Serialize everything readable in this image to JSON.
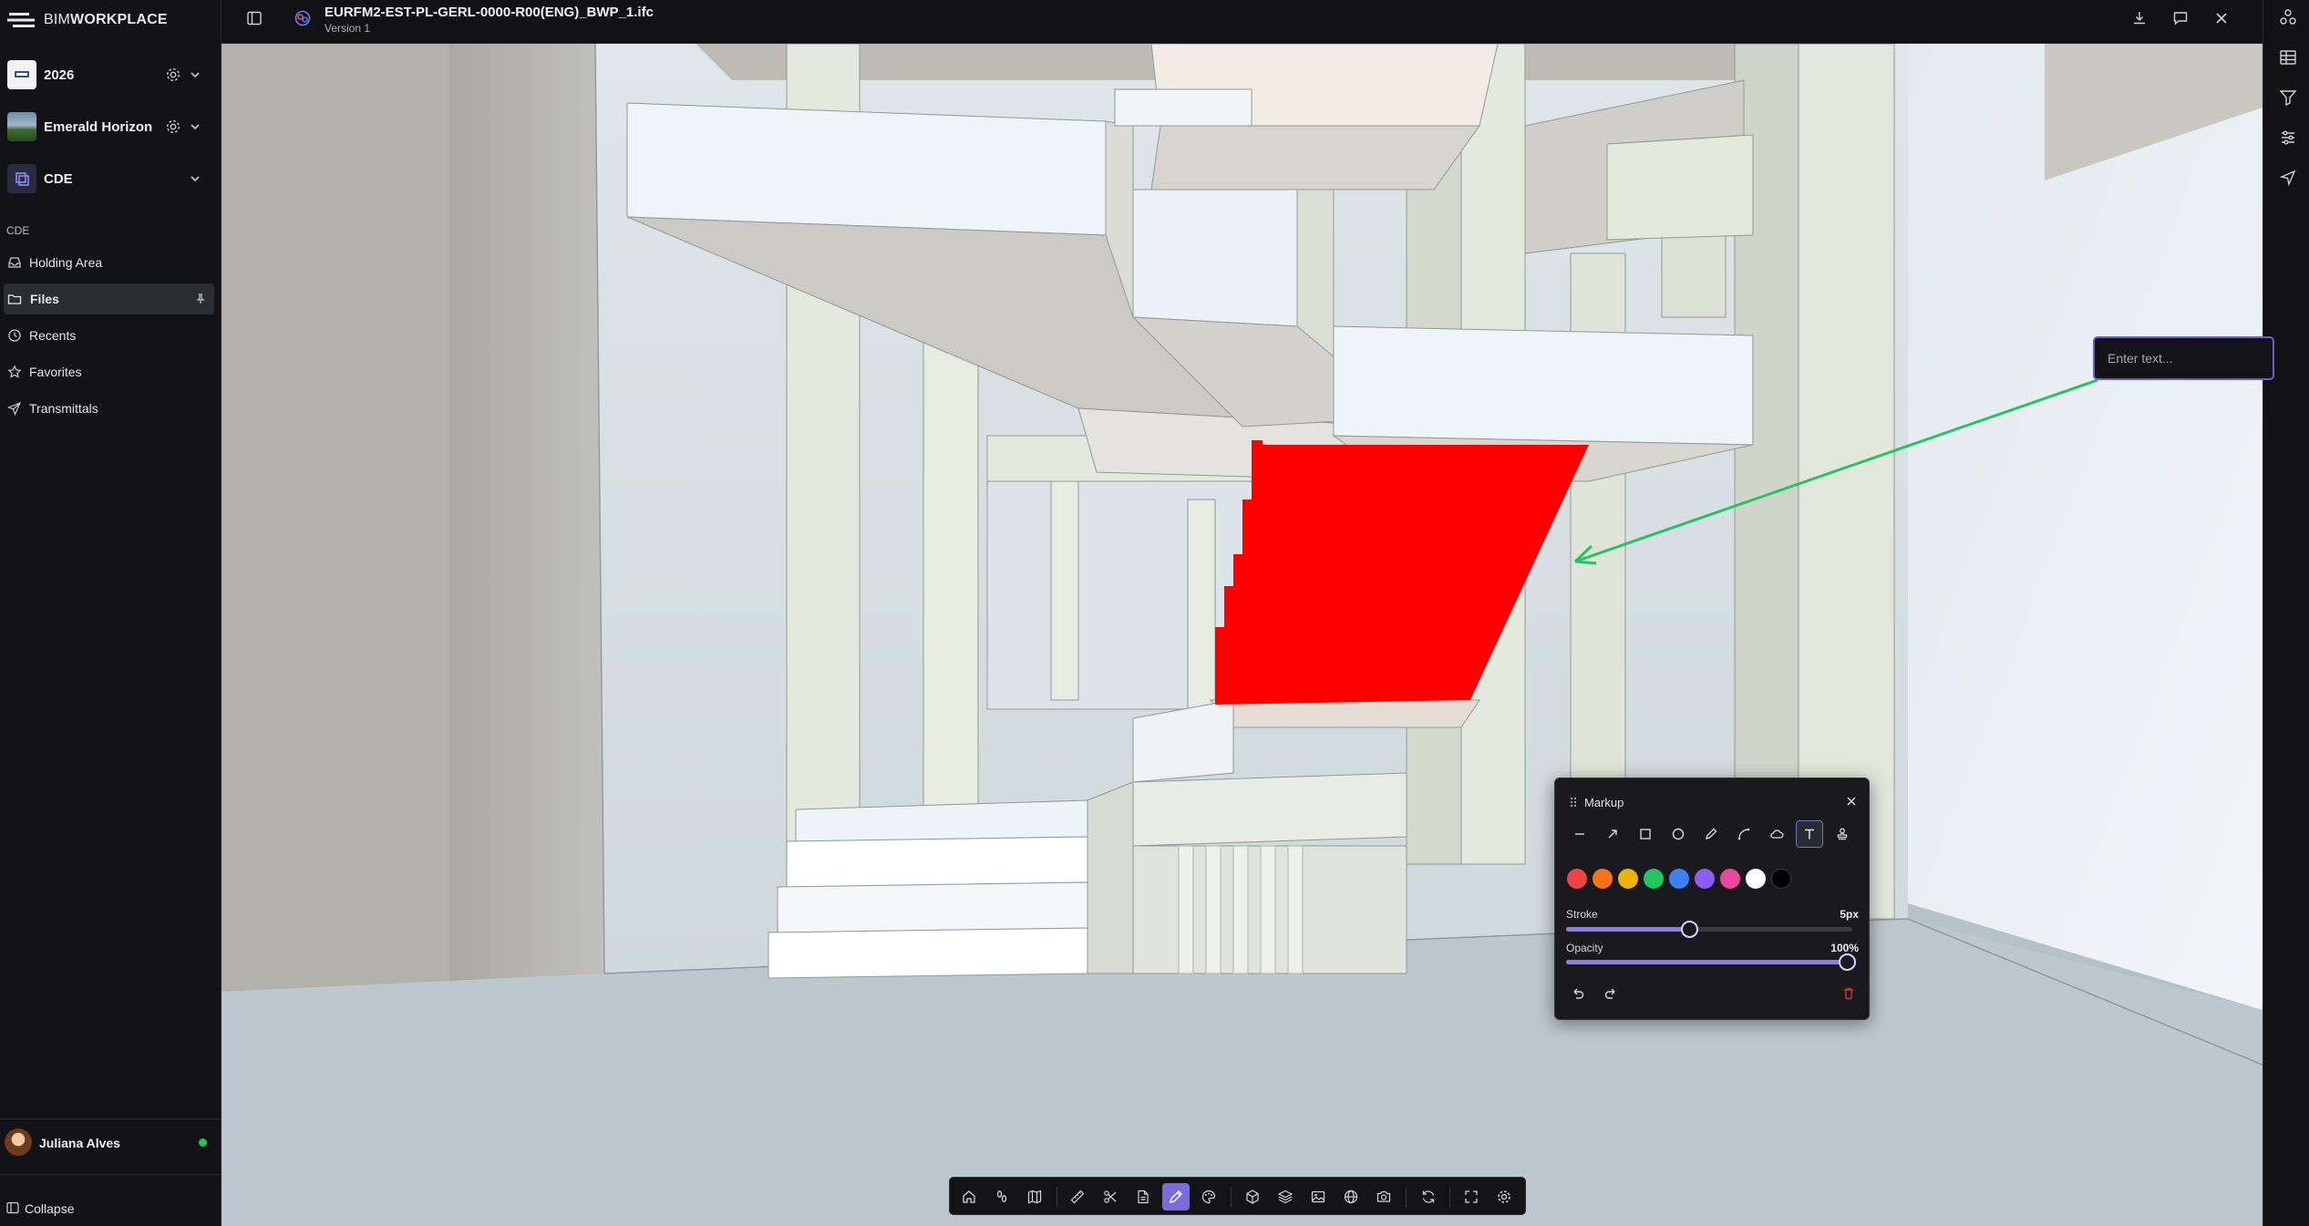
{
  "app": {
    "logo_bold": "WORKPLACE",
    "logo_thin": "BIM"
  },
  "sidebar": {
    "projects": [
      {
        "name": "2026"
      },
      {
        "name": "Emerald Horizon"
      },
      {
        "name": "CDE"
      }
    ],
    "section_label": "CDE",
    "nav": [
      {
        "label": "Holding Area",
        "icon": "inbox-icon"
      },
      {
        "label": "Files",
        "icon": "folder-icon",
        "active": true
      },
      {
        "label": "Recents",
        "icon": "clock-icon"
      },
      {
        "label": "Favorites",
        "icon": "star-icon"
      },
      {
        "label": "Transmittals",
        "icon": "send-icon"
      }
    ],
    "user": {
      "name": "Juliana Alves",
      "status_color": "#22c55e"
    },
    "collapse_label": "Collapse"
  },
  "topbar": {
    "file_name": "EURFM2-EST-PL-GERL-0000-R00(ENG)_BWP_1.ifc",
    "version": "Version 1"
  },
  "annotation": {
    "placeholder": "Enter text...",
    "arrow_color": "#22c55e",
    "highlight_color": "#ff0000"
  },
  "markup": {
    "title": "Markup",
    "tools": [
      "line-icon",
      "arrow-icon",
      "rectangle-icon",
      "circle-icon",
      "pencil-icon",
      "curve-icon",
      "cloud-icon",
      "text-icon",
      "stamp-icon"
    ],
    "active_tool": "text-icon",
    "colors": [
      "#ef4444",
      "#f97316",
      "#eab308",
      "#22c55e",
      "#3b82f6",
      "#8b5cf6",
      "#ec4899",
      "#ffffff",
      "#000000"
    ],
    "stroke_label": "Stroke",
    "stroke_value": "5px",
    "stroke_fraction": 0.43,
    "opacity_label": "Opacity",
    "opacity_value": "100%",
    "opacity_fraction": 1.0
  },
  "bottom_toolbar": {
    "buttons": [
      "home-icon",
      "walk-icon",
      "map-icon",
      "measure-icon",
      "cut-icon",
      "document-icon",
      "markup-pen-icon",
      "palette-icon",
      "cube-icon",
      "layers-icon",
      "image-icon",
      "globe-icon",
      "camera-icon",
      "refresh-icon",
      "fullscreen-icon",
      "settings-icon"
    ],
    "active": "markup-pen-icon"
  }
}
